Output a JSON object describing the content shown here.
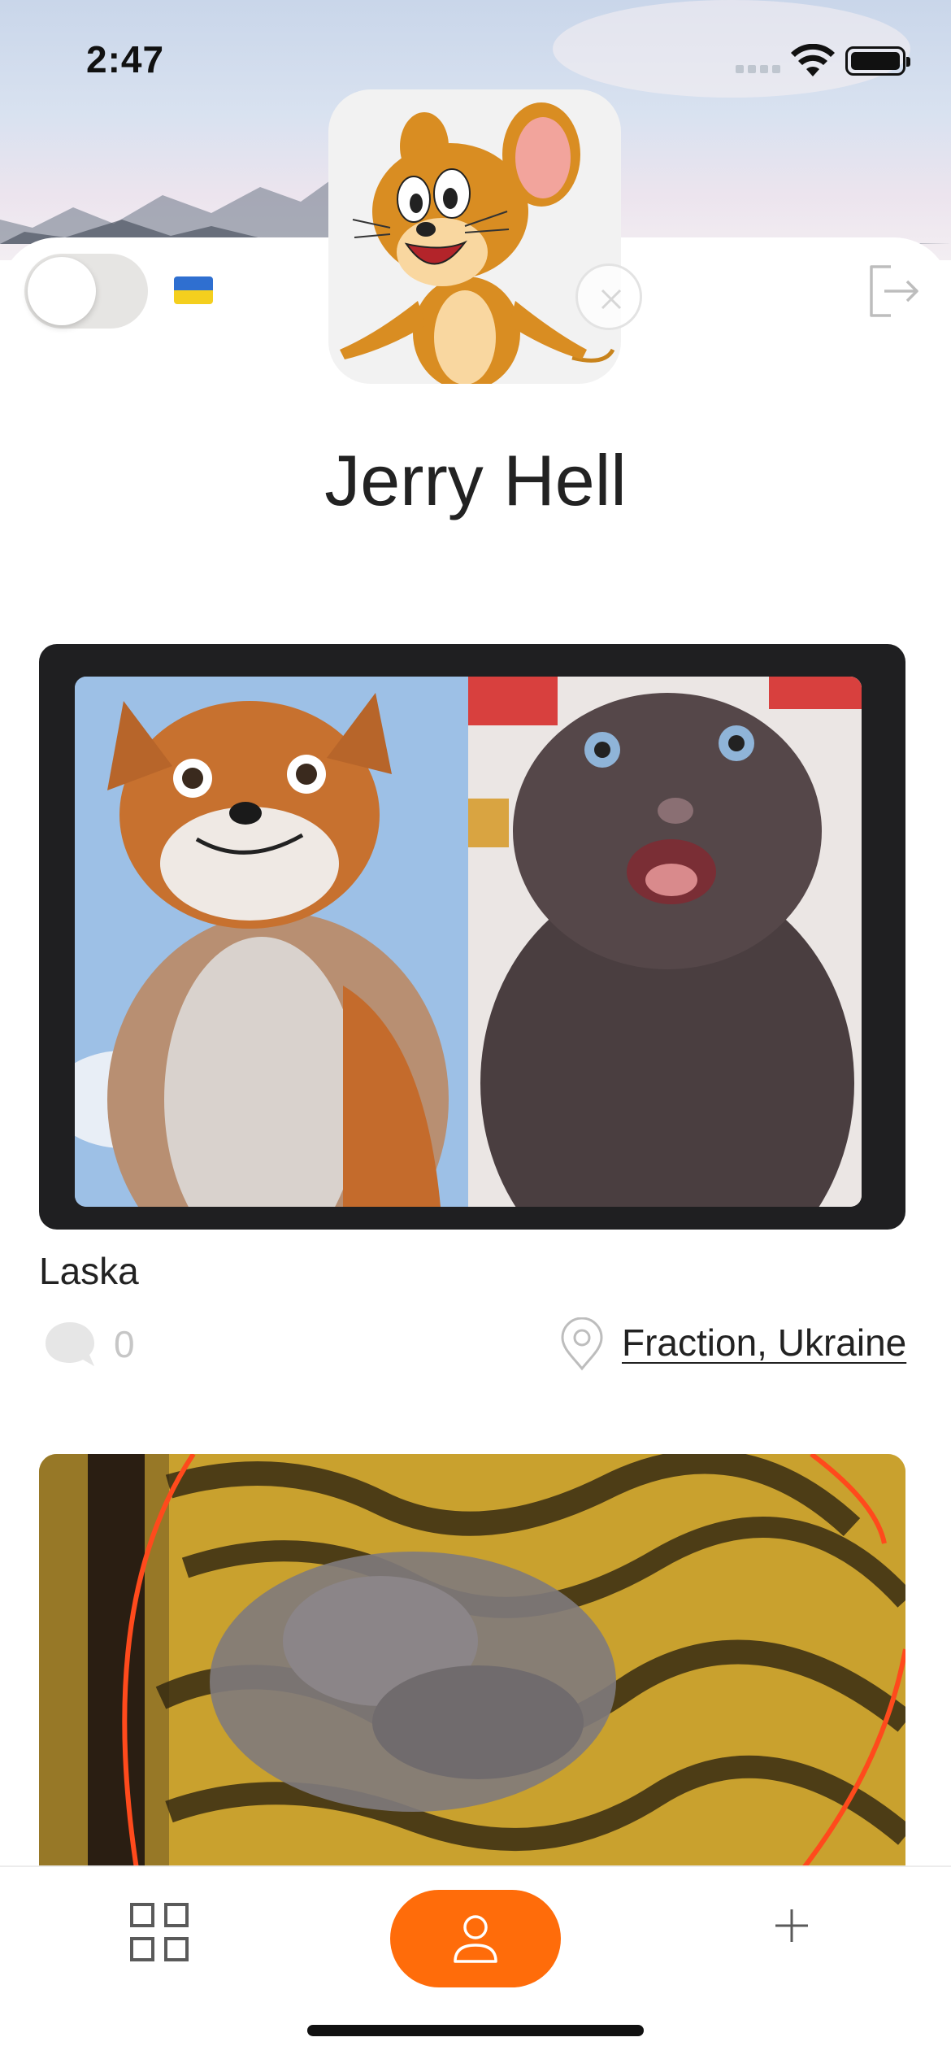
{
  "status_bar": {
    "time": "2:47"
  },
  "header": {
    "language_flag": "ukraine-flag-icon",
    "toggle_on": false
  },
  "profile": {
    "name": "Jerry Hell"
  },
  "posts": [
    {
      "title": "Laska",
      "comment_count": "0",
      "location": "Fraction, Ukraine"
    }
  ],
  "tab_bar": {
    "items": [
      "grid-icon",
      "profile-icon",
      "plus-icon"
    ],
    "active": "profile-icon"
  },
  "colors": {
    "accent": "#ff6c0a",
    "card_frame": "#1f1f21",
    "muted_text": "#c6c6c6",
    "toggle_track": "#e6e5e3"
  }
}
